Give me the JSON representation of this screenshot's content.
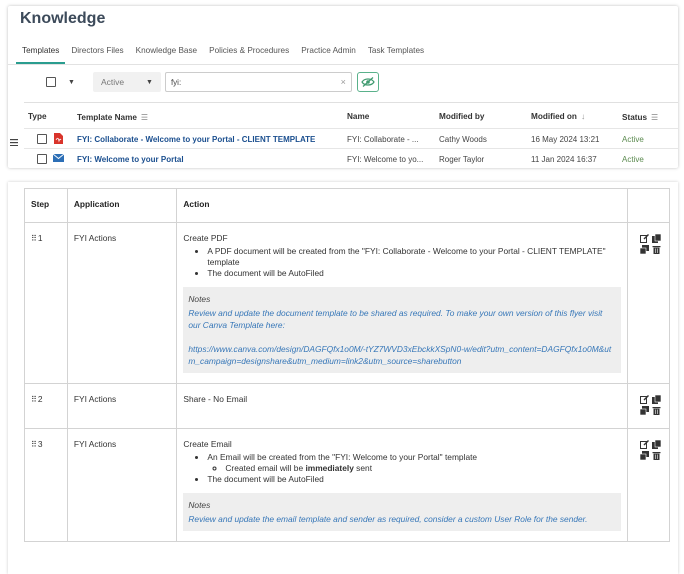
{
  "app": {
    "title": "Knowledge"
  },
  "tabs": [
    "Templates",
    "Directors Files",
    "Knowledge Base",
    "Policies & Procedures",
    "Practice Admin",
    "Task Templates"
  ],
  "filter": {
    "status_value": "Active",
    "search_value": "fyi:",
    "clear_glyph": "×"
  },
  "grid": {
    "headers": {
      "type": "Type",
      "template_name": "Template Name",
      "name": "Name",
      "modified_by": "Modified by",
      "modified_on": "Modified on",
      "status": "Status"
    },
    "rows": [
      {
        "icon": "pdf-icon",
        "template_name": "FYI: Collaborate - Welcome to your Portal - CLIENT TEMPLATE",
        "name": "FYI: Collaborate - ...",
        "modified_by": "Cathy Woods",
        "modified_on": "16 May 2024 13:21",
        "status": "Active"
      },
      {
        "icon": "email-icon",
        "template_name": "FYI: Welcome to your Portal",
        "name": "FYI: Welcome to yo...",
        "modified_by": "Roger Taylor",
        "modified_on": "11 Jan 2024 16:37",
        "status": "Active"
      }
    ]
  },
  "steps_table": {
    "headers": {
      "step": "Step",
      "application": "Application",
      "action": "Action"
    },
    "rows": [
      {
        "step": "1",
        "application": "FYI Actions",
        "action_title": "Create PDF",
        "bullets": [
          "A PDF document will be created from the \"FYI: Collaborate - Welcome to your Portal - CLIENT TEMPLATE\" template",
          "The document will be AutoFiled"
        ],
        "notes_label": "Notes",
        "notes_text": "Review and update the document template to be shared as required. To make your own version of this flyer visit our Canva Template here:",
        "notes_link": "https://www.canva.com/design/DAGFQfx1o0M/-tYZ7WVD3xEbckkXSpN0-w/edit?utm_content=DAGFQfx1o0M&utm_campaign=designshare&utm_medium=link2&utm_source=sharebutton"
      },
      {
        "step": "2",
        "application": "FYI Actions",
        "action_title": "Share - No Email"
      },
      {
        "step": "3",
        "application": "FYI Actions",
        "action_title": "Create Email",
        "bullet_1": "An Email will be created from the \"FYI: Welcome to your Portal\" template",
        "sub_prefix": "Created email will be ",
        "sub_bold": "immediately",
        "sub_suffix": " sent",
        "bullet_2": "The document will be AutoFiled",
        "notes_label": "Notes",
        "notes_text": "Review and update the email template and sender as required, consider a custom User Role for the sender."
      }
    ]
  },
  "colors": {
    "accent": "#2a9d8f",
    "link": "#1b4f8f",
    "note_link": "#3777b8",
    "pdf": "#d9342b",
    "email": "#2d6fb6"
  }
}
